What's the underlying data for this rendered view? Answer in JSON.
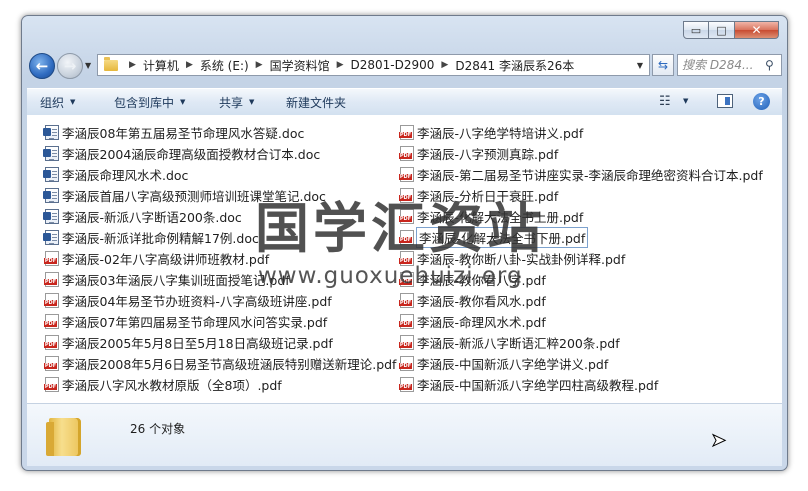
{
  "window": {
    "caption": {
      "minimize": "▭",
      "maximize": "□",
      "close": "✕"
    }
  },
  "address": {
    "crumbs": [
      "计算机",
      "系统 (E:)",
      "国学资料馆",
      "D2801-D2900",
      "D2841 李涵辰系26本"
    ]
  },
  "search": {
    "placeholder": "搜索 D284..."
  },
  "toolbar": {
    "organize": "组织",
    "include_in_library": "包含到库中",
    "share": "共享",
    "new_folder": "新建文件夹"
  },
  "files_left": [
    {
      "name": "李涵辰08年第五届易圣节命理风水答疑.doc",
      "type": "doc"
    },
    {
      "name": "李涵辰2004涵辰命理高级面授教材合订本.doc",
      "type": "doc"
    },
    {
      "name": "李涵辰命理风水术.doc",
      "type": "doc"
    },
    {
      "name": "李涵辰首届八字高级预测师培训班课堂笔记.doc",
      "type": "doc"
    },
    {
      "name": "李涵辰-新派八字断语200条.doc",
      "type": "doc"
    },
    {
      "name": "李涵辰-新派详批命例精解17例.doc",
      "type": "doc"
    },
    {
      "name": "李涵辰-02年八字高级讲师班教材.pdf",
      "type": "pdf"
    },
    {
      "name": "李涵辰03年涵辰八字集训班面授笔记.pdf",
      "type": "pdf"
    },
    {
      "name": "李涵辰04年易圣节办班资料-八字高级班讲座.pdf",
      "type": "pdf"
    },
    {
      "name": "李涵辰07年第四届易圣节命理风水问答实录.pdf",
      "type": "pdf"
    },
    {
      "name": "李涵辰2005年5月8日至5月18日高级班记录.pdf",
      "type": "pdf"
    },
    {
      "name": "李涵辰2008年5月6日易圣节高级班涵辰特别赠送新理论.pdf",
      "type": "pdf"
    },
    {
      "name": "李涵辰八字风水教材原版（全8项）.pdf",
      "type": "pdf"
    }
  ],
  "files_right": [
    {
      "name": "李涵辰-八字绝学特培讲义.pdf",
      "type": "pdf"
    },
    {
      "name": "李涵辰-八字预测真踪.pdf",
      "type": "pdf"
    },
    {
      "name": "李涵辰-第二届易圣节讲座实录-李涵辰命理绝密资料合订本.pdf",
      "type": "pdf"
    },
    {
      "name": "李涵辰-分析日干衰旺.pdf",
      "type": "pdf"
    },
    {
      "name": "李涵辰-化解大法全书上册.pdf",
      "type": "pdf"
    },
    {
      "name": "李涵辰-化解大法全书下册.pdf",
      "type": "pdf",
      "selected": true
    },
    {
      "name": "李涵辰-教你断八卦-实战卦例详释.pdf",
      "type": "pdf"
    },
    {
      "name": "李涵辰-教你看八字.pdf",
      "type": "pdf"
    },
    {
      "name": "李涵辰-教你看风水.pdf",
      "type": "pdf"
    },
    {
      "name": "李涵辰-命理风水术.pdf",
      "type": "pdf"
    },
    {
      "name": "李涵辰-新派八字断语汇粹200条.pdf",
      "type": "pdf"
    },
    {
      "name": "李涵辰-中国新派八字绝学讲义.pdf",
      "type": "pdf"
    },
    {
      "name": "李涵辰-中国新派八字绝学四柱高级教程.pdf",
      "type": "pdf"
    }
  ],
  "watermark": {
    "text": "国学汇资站",
    "url": "www.guoxuehuizi.org"
  },
  "status": {
    "count": "26 个对象"
  },
  "icons": {
    "back": "arrow-left-icon",
    "forward": "arrow-right-icon",
    "refresh": "refresh-icon",
    "search": "search-icon",
    "view": "view-options-icon",
    "preview": "preview-pane-icon",
    "help": "help-icon",
    "doc": "word-document-icon",
    "pdf": "pdf-document-icon",
    "folder": "folder-icon"
  }
}
